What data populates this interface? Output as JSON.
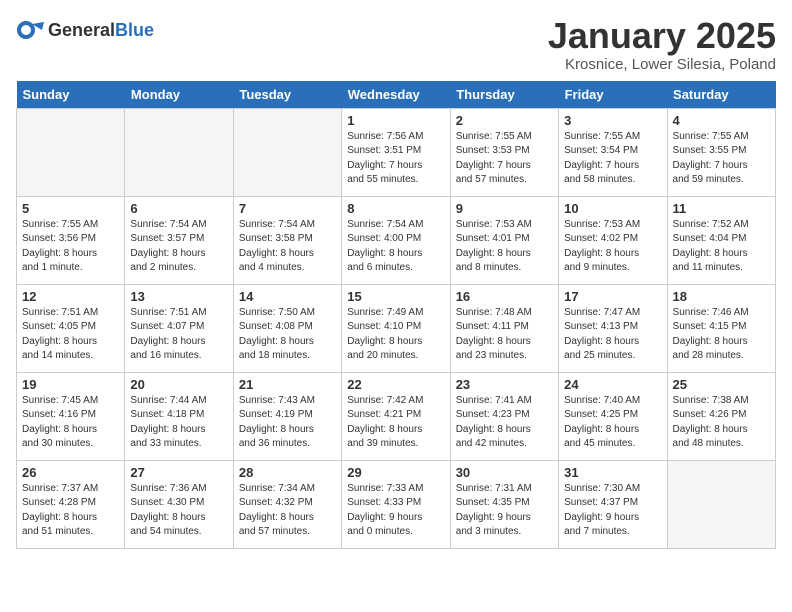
{
  "header": {
    "logo_general": "General",
    "logo_blue": "Blue",
    "title": "January 2025",
    "subtitle": "Krosnice, Lower Silesia, Poland"
  },
  "days_of_week": [
    "Sunday",
    "Monday",
    "Tuesday",
    "Wednesday",
    "Thursday",
    "Friday",
    "Saturday"
  ],
  "weeks": [
    [
      {
        "day": "",
        "info": ""
      },
      {
        "day": "",
        "info": ""
      },
      {
        "day": "",
        "info": ""
      },
      {
        "day": "1",
        "info": "Sunrise: 7:56 AM\nSunset: 3:51 PM\nDaylight: 7 hours\nand 55 minutes."
      },
      {
        "day": "2",
        "info": "Sunrise: 7:55 AM\nSunset: 3:53 PM\nDaylight: 7 hours\nand 57 minutes."
      },
      {
        "day": "3",
        "info": "Sunrise: 7:55 AM\nSunset: 3:54 PM\nDaylight: 7 hours\nand 58 minutes."
      },
      {
        "day": "4",
        "info": "Sunrise: 7:55 AM\nSunset: 3:55 PM\nDaylight: 7 hours\nand 59 minutes."
      }
    ],
    [
      {
        "day": "5",
        "info": "Sunrise: 7:55 AM\nSunset: 3:56 PM\nDaylight: 8 hours\nand 1 minute."
      },
      {
        "day": "6",
        "info": "Sunrise: 7:54 AM\nSunset: 3:57 PM\nDaylight: 8 hours\nand 2 minutes."
      },
      {
        "day": "7",
        "info": "Sunrise: 7:54 AM\nSunset: 3:58 PM\nDaylight: 8 hours\nand 4 minutes."
      },
      {
        "day": "8",
        "info": "Sunrise: 7:54 AM\nSunset: 4:00 PM\nDaylight: 8 hours\nand 6 minutes."
      },
      {
        "day": "9",
        "info": "Sunrise: 7:53 AM\nSunset: 4:01 PM\nDaylight: 8 hours\nand 8 minutes."
      },
      {
        "day": "10",
        "info": "Sunrise: 7:53 AM\nSunset: 4:02 PM\nDaylight: 8 hours\nand 9 minutes."
      },
      {
        "day": "11",
        "info": "Sunrise: 7:52 AM\nSunset: 4:04 PM\nDaylight: 8 hours\nand 11 minutes."
      }
    ],
    [
      {
        "day": "12",
        "info": "Sunrise: 7:51 AM\nSunset: 4:05 PM\nDaylight: 8 hours\nand 14 minutes."
      },
      {
        "day": "13",
        "info": "Sunrise: 7:51 AM\nSunset: 4:07 PM\nDaylight: 8 hours\nand 16 minutes."
      },
      {
        "day": "14",
        "info": "Sunrise: 7:50 AM\nSunset: 4:08 PM\nDaylight: 8 hours\nand 18 minutes."
      },
      {
        "day": "15",
        "info": "Sunrise: 7:49 AM\nSunset: 4:10 PM\nDaylight: 8 hours\nand 20 minutes."
      },
      {
        "day": "16",
        "info": "Sunrise: 7:48 AM\nSunset: 4:11 PM\nDaylight: 8 hours\nand 23 minutes."
      },
      {
        "day": "17",
        "info": "Sunrise: 7:47 AM\nSunset: 4:13 PM\nDaylight: 8 hours\nand 25 minutes."
      },
      {
        "day": "18",
        "info": "Sunrise: 7:46 AM\nSunset: 4:15 PM\nDaylight: 8 hours\nand 28 minutes."
      }
    ],
    [
      {
        "day": "19",
        "info": "Sunrise: 7:45 AM\nSunset: 4:16 PM\nDaylight: 8 hours\nand 30 minutes."
      },
      {
        "day": "20",
        "info": "Sunrise: 7:44 AM\nSunset: 4:18 PM\nDaylight: 8 hours\nand 33 minutes."
      },
      {
        "day": "21",
        "info": "Sunrise: 7:43 AM\nSunset: 4:19 PM\nDaylight: 8 hours\nand 36 minutes."
      },
      {
        "day": "22",
        "info": "Sunrise: 7:42 AM\nSunset: 4:21 PM\nDaylight: 8 hours\nand 39 minutes."
      },
      {
        "day": "23",
        "info": "Sunrise: 7:41 AM\nSunset: 4:23 PM\nDaylight: 8 hours\nand 42 minutes."
      },
      {
        "day": "24",
        "info": "Sunrise: 7:40 AM\nSunset: 4:25 PM\nDaylight: 8 hours\nand 45 minutes."
      },
      {
        "day": "25",
        "info": "Sunrise: 7:38 AM\nSunset: 4:26 PM\nDaylight: 8 hours\nand 48 minutes."
      }
    ],
    [
      {
        "day": "26",
        "info": "Sunrise: 7:37 AM\nSunset: 4:28 PM\nDaylight: 8 hours\nand 51 minutes."
      },
      {
        "day": "27",
        "info": "Sunrise: 7:36 AM\nSunset: 4:30 PM\nDaylight: 8 hours\nand 54 minutes."
      },
      {
        "day": "28",
        "info": "Sunrise: 7:34 AM\nSunset: 4:32 PM\nDaylight: 8 hours\nand 57 minutes."
      },
      {
        "day": "29",
        "info": "Sunrise: 7:33 AM\nSunset: 4:33 PM\nDaylight: 9 hours\nand 0 minutes."
      },
      {
        "day": "30",
        "info": "Sunrise: 7:31 AM\nSunset: 4:35 PM\nDaylight: 9 hours\nand 3 minutes."
      },
      {
        "day": "31",
        "info": "Sunrise: 7:30 AM\nSunset: 4:37 PM\nDaylight: 9 hours\nand 7 minutes."
      },
      {
        "day": "",
        "info": ""
      }
    ]
  ]
}
